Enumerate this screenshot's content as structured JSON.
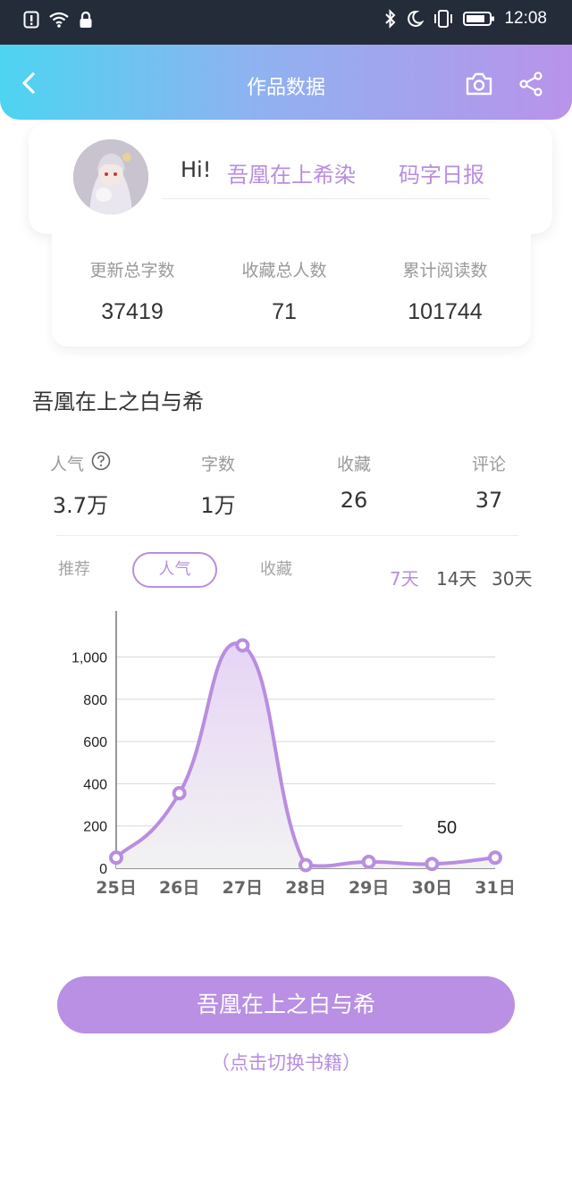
{
  "status_bar": {
    "time": "12:08"
  },
  "app_bar": {
    "title": "作品数据"
  },
  "user": {
    "greeting": "Hi!",
    "author_name": "吾凰在上希染",
    "daily_report": "码字日报"
  },
  "stats": [
    {
      "label": "更新总字数",
      "value": "37419"
    },
    {
      "label": "收藏总人数",
      "value": "71"
    },
    {
      "label": "累计阅读数",
      "value": "101744"
    }
  ],
  "book": {
    "title": "吾凰在上之白与希"
  },
  "metrics": [
    {
      "label": "人气",
      "value": "3.7万"
    },
    {
      "label": "字数",
      "value": "1万"
    },
    {
      "label": "收藏",
      "value": "26"
    },
    {
      "label": "评论",
      "value": "37"
    }
  ],
  "tabs": [
    {
      "label": "推荐",
      "active": false
    },
    {
      "label": "人气",
      "active": true
    },
    {
      "label": "收藏",
      "active": false
    }
  ],
  "ranges": [
    {
      "label": "7天",
      "active": true
    },
    {
      "label": "14天",
      "active": false
    },
    {
      "label": "30天",
      "active": false
    }
  ],
  "chart_data": {
    "type": "area",
    "categories": [
      "25日",
      "26日",
      "27日",
      "28日",
      "29日",
      "30日",
      "31日"
    ],
    "values": [
      50,
      355,
      1055,
      15,
      30,
      20,
      50
    ],
    "ylim": [
      0,
      1150
    ],
    "yticks": [
      0,
      200,
      400,
      600,
      800,
      1000
    ],
    "ytick_labels": [
      "0",
      "200",
      "400",
      "600",
      "800",
      "1,000"
    ],
    "tooltip": {
      "index": 6,
      "text": "50"
    },
    "grid": true,
    "colors": {
      "line": "#b88ee0",
      "fill_top": "#e6d4f5",
      "fill_bottom": "#f2f2f2",
      "grid": "#d8d8d8"
    }
  },
  "switch_button": {
    "label": "吾凰在上之白与希",
    "hint": "（点击切换书籍）"
  }
}
